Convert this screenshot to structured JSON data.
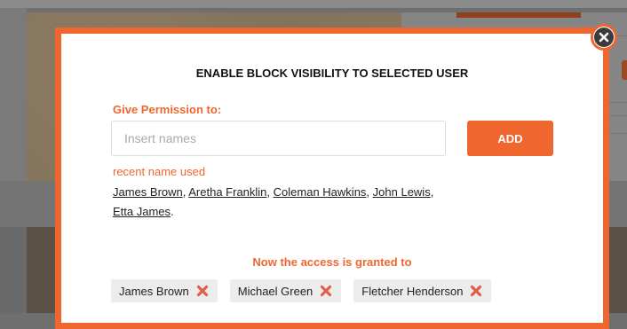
{
  "modal": {
    "title": "ENABLE BLOCK VISIBILITY TO SELECTED USER",
    "permission_label": "Give Permission to:",
    "input_placeholder": "Insert names",
    "input_value": "",
    "add_label": "ADD",
    "recent_label": "recent name used",
    "recent_names": [
      "James Brown",
      "Aretha Franklin",
      "Coleman Hawkins",
      "John Lewis",
      "Etta James"
    ],
    "granted_label": "Now the access is granted to",
    "granted_users": [
      "James Brown",
      "Michael Green",
      "Fletcher Henderson"
    ]
  },
  "colors": {
    "accent": "#f0662f",
    "overlay": "#6f6f6f",
    "tag_bg": "#ececec",
    "remove_icon": "#e0604a"
  },
  "icons": {
    "close": "close-icon",
    "remove": "remove-x-icon"
  }
}
